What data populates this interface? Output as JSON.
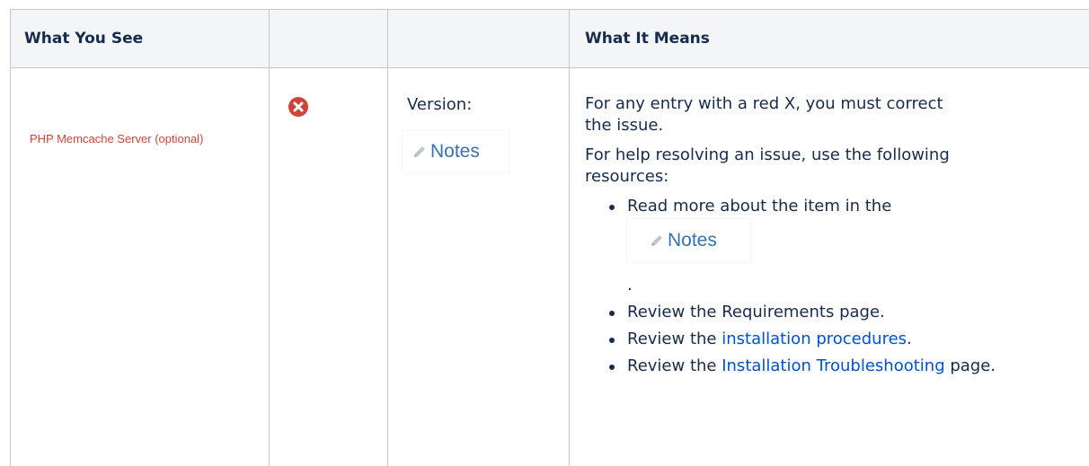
{
  "table": {
    "headers": [
      "What You See",
      "",
      "",
      "What It Means"
    ],
    "row": {
      "what_you_see": "PHP Memcache Server (optional)",
      "status_icon": "error-x-icon",
      "version_label": "Version:",
      "notes_label": "Notes",
      "meaning": {
        "p1": "For any entry with a red X, you must correct the issue.",
        "p2": "For help resolving an issue, use the following resources:",
        "bullets": {
          "b1_text": "Read more about the item in the",
          "b1_notes": "Notes",
          "b1_period": ".",
          "b2_text": "Review the Requirements page.",
          "b3_prefix": "Review the ",
          "b3_link": "installation procedures",
          "b3_suffix": ".",
          "b4_prefix": "Review the ",
          "b4_link": "Installation Troubleshooting",
          "b4_suffix": " page."
        }
      }
    }
  },
  "colors": {
    "red_label": "#d04437",
    "error_icon": "#d04437",
    "link": "#0052cc",
    "notes": "#3572b0",
    "header_bg": "#f4f5f7"
  }
}
